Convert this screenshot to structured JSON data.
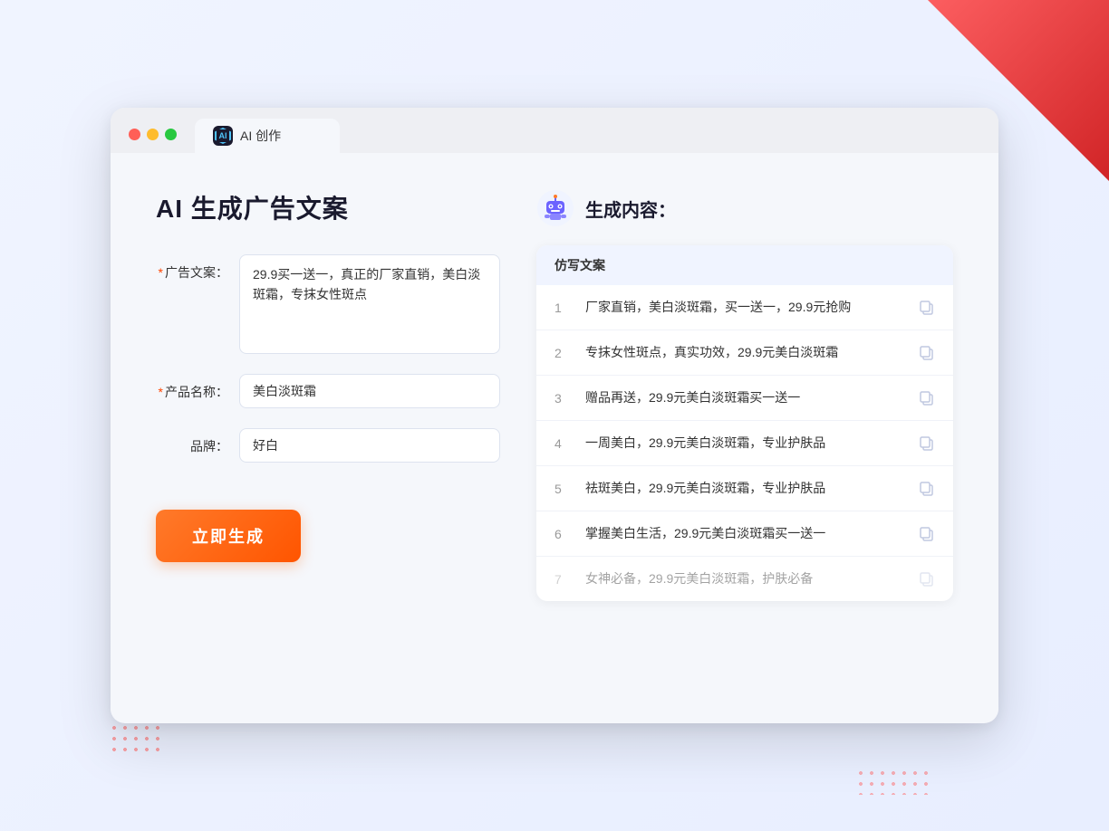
{
  "window": {
    "controls": {
      "close": "close",
      "minimize": "minimize",
      "maximize": "maximize"
    },
    "tab": {
      "label": "AI 创作",
      "icon_text": "AI"
    }
  },
  "left_panel": {
    "title": "AI 生成广告文案",
    "form": {
      "ad_copy_label": "广告文案：",
      "ad_copy_required": "*",
      "ad_copy_value": "29.9买一送一，真正的厂家直销，美白淡斑霜，专抹女性斑点",
      "product_name_label": "产品名称：",
      "product_name_required": "*",
      "product_name_value": "美白淡斑霜",
      "brand_label": "品牌：",
      "brand_value": "好白"
    },
    "generate_button": "立即生成"
  },
  "right_panel": {
    "header": {
      "title": "生成内容："
    },
    "table": {
      "column_header": "仿写文案",
      "rows": [
        {
          "num": "1",
          "text": "厂家直销，美白淡斑霜，买一送一，29.9元抢购",
          "dimmed": false
        },
        {
          "num": "2",
          "text": "专抹女性斑点，真实功效，29.9元美白淡斑霜",
          "dimmed": false
        },
        {
          "num": "3",
          "text": "赠品再送，29.9元美白淡斑霜买一送一",
          "dimmed": false
        },
        {
          "num": "4",
          "text": "一周美白，29.9元美白淡斑霜，专业护肤品",
          "dimmed": false
        },
        {
          "num": "5",
          "text": "祛斑美白，29.9元美白淡斑霜，专业护肤品",
          "dimmed": false
        },
        {
          "num": "6",
          "text": "掌握美白生活，29.9元美白淡斑霜买一送一",
          "dimmed": false
        },
        {
          "num": "7",
          "text": "女神必备，29.9元美白淡斑霜，护肤必备",
          "dimmed": true
        }
      ]
    }
  }
}
